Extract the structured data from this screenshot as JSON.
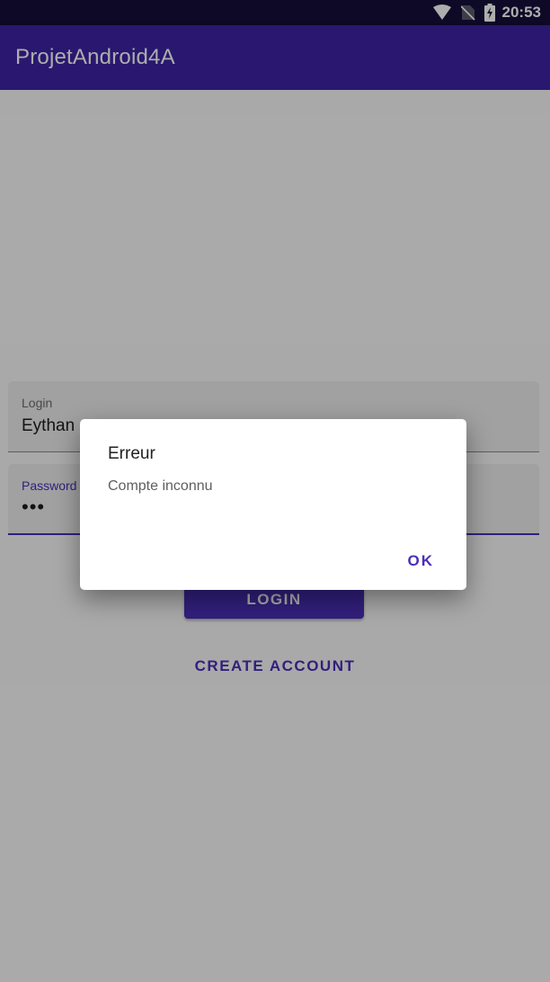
{
  "status_bar": {
    "time": "20:53",
    "icons": [
      "wifi-icon",
      "no-sim-icon",
      "battery-charging-icon"
    ]
  },
  "app_bar": {
    "title": "ProjetAndroid4A",
    "color": "#3f22a6"
  },
  "form": {
    "login": {
      "label": "Login",
      "value": "Eythan"
    },
    "password": {
      "label": "Password",
      "value": "•••"
    },
    "login_button": "LOGIN",
    "create_account_button": "CREATE ACCOUNT"
  },
  "dialog": {
    "title": "Erreur",
    "message": "Compte inconnu",
    "ok_button": "OK"
  },
  "colors": {
    "primary": "#4a2fb8",
    "status_bar": "#140e3a"
  }
}
